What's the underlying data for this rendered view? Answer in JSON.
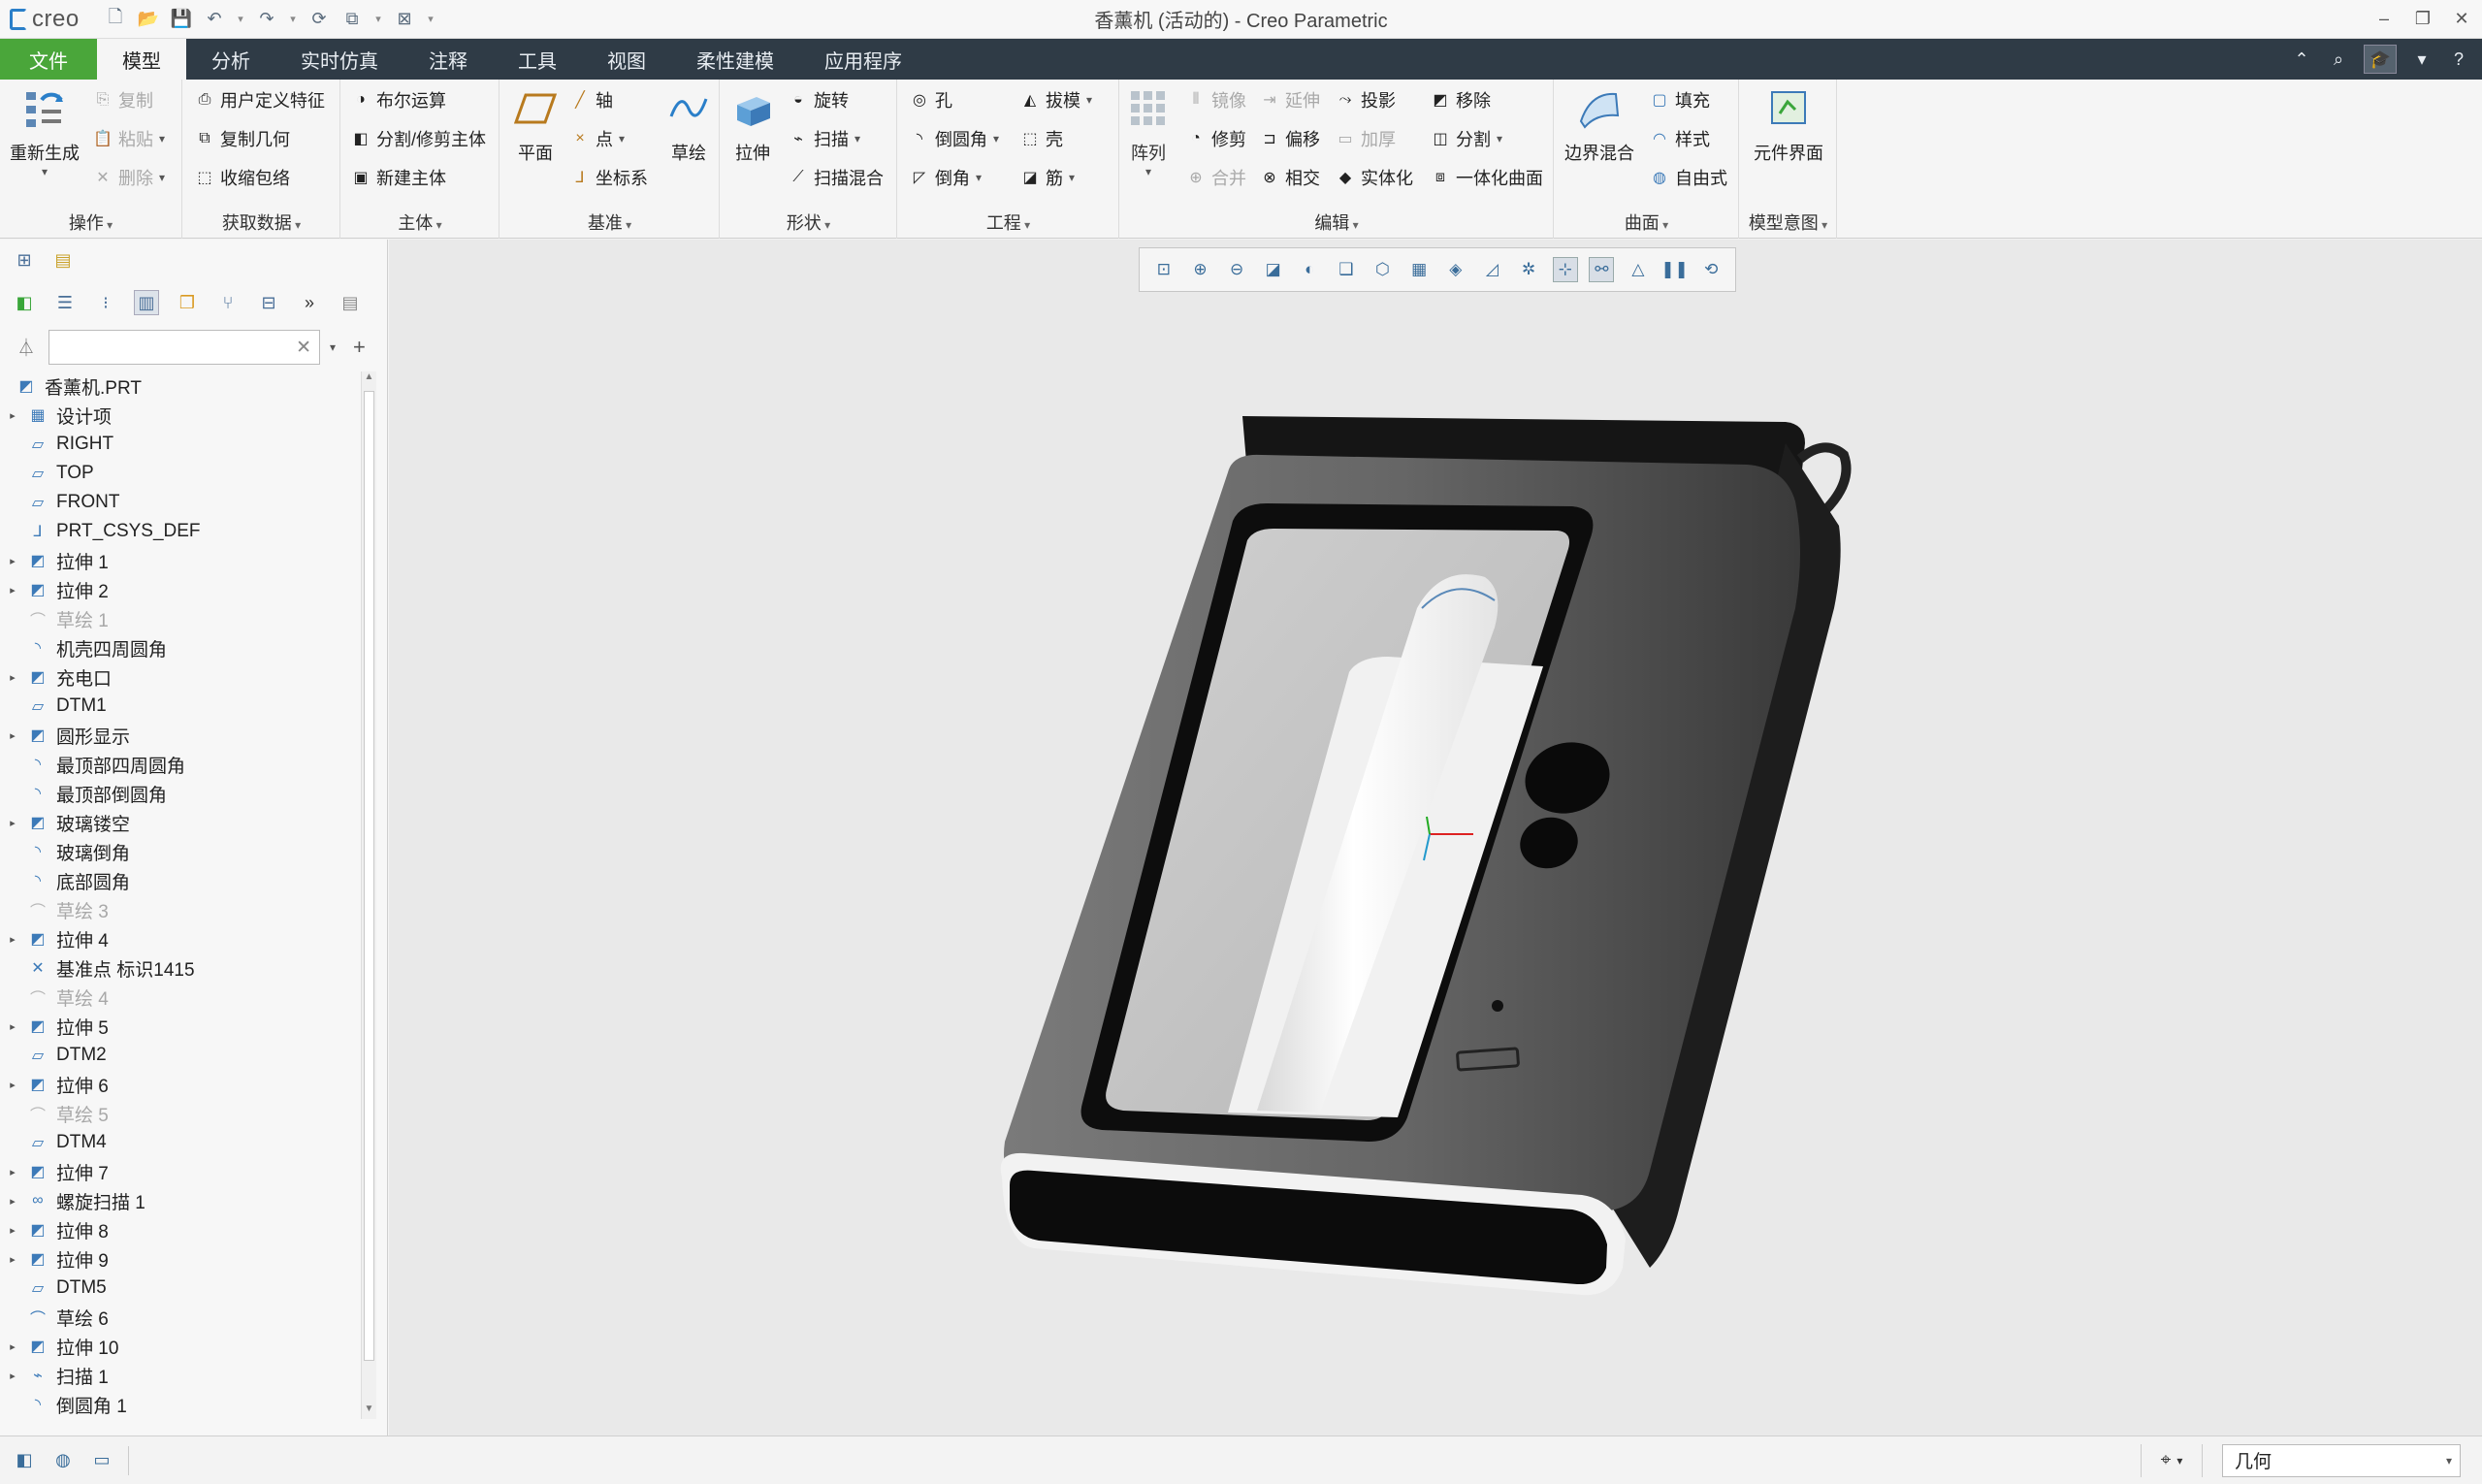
{
  "app": {
    "logo_text": "creo",
    "window_title": "香薰机 (活动的) - Creo Parametric"
  },
  "tabs": [
    "文件",
    "模型",
    "分析",
    "实时仿真",
    "注释",
    "工具",
    "视图",
    "柔性建模",
    "应用程序"
  ],
  "active_tab": "模型",
  "ribbon": {
    "operations": {
      "title": "操作",
      "regenerate": "重新生成",
      "copy": "复制",
      "paste": "粘贴",
      "delete": "删除"
    },
    "get_data": {
      "title": "获取数据",
      "udf": "用户定义特征",
      "copy_geom": "复制几何",
      "shrinkwrap": "收缩包络"
    },
    "body": {
      "title": "主体",
      "boolean": "布尔运算",
      "split_trim": "分割/修剪主体",
      "new_body": "新建主体"
    },
    "datum": {
      "title": "基准",
      "plane": "平面",
      "axis": "轴",
      "point": "点",
      "csys": "坐标系",
      "sketch": "草绘"
    },
    "shapes": {
      "title": "形状",
      "extrude": "拉伸",
      "revolve": "旋转",
      "sweep": "扫描",
      "swept_blend": "扫描混合"
    },
    "engineering": {
      "title": "工程",
      "hole": "孔",
      "round": "倒圆角",
      "chamfer": "倒角",
      "draft": "拔模",
      "shell": "壳",
      "rib": "筋"
    },
    "editing": {
      "title": "编辑",
      "pattern": "阵列",
      "mirror": "镜像",
      "trim": "修剪",
      "merge": "合并",
      "extend": "延伸",
      "offset": "偏移",
      "intersect": "相交",
      "project": "投影",
      "thicken": "加厚",
      "solidify": "实体化",
      "remove": "移除",
      "split": "分割",
      "unify_surface": "一体化曲面"
    },
    "surfaces": {
      "title": "曲面",
      "boundary_blend": "边界混合",
      "fill": "填充",
      "style": "样式",
      "freestyle": "自由式"
    },
    "model_intent": {
      "title": "模型意图",
      "component_interface": "元件界面"
    }
  },
  "model_tree": {
    "root": "香薰机.PRT",
    "items": [
      {
        "label": "设计项",
        "icon": "design-items-icon",
        "expandable": true,
        "dim": false
      },
      {
        "label": "RIGHT",
        "icon": "datum-plane-icon",
        "expandable": false,
        "dim": false
      },
      {
        "label": "TOP",
        "icon": "datum-plane-icon",
        "expandable": false,
        "dim": false
      },
      {
        "label": "FRONT",
        "icon": "datum-plane-icon",
        "expandable": false,
        "dim": false
      },
      {
        "label": "PRT_CSYS_DEF",
        "icon": "csys-icon",
        "expandable": false,
        "dim": false
      },
      {
        "label": "拉伸 1",
        "icon": "extrude-icon",
        "expandable": true,
        "dim": false
      },
      {
        "label": "拉伸 2",
        "icon": "extrude-icon",
        "expandable": true,
        "dim": false
      },
      {
        "label": "草绘 1",
        "icon": "sketch-icon",
        "expandable": false,
        "dim": true
      },
      {
        "label": "机壳四周圆角",
        "icon": "round-icon",
        "expandable": false,
        "dim": false
      },
      {
        "label": "充电口",
        "icon": "extrude-icon",
        "expandable": true,
        "dim": false
      },
      {
        "label": "DTM1",
        "icon": "datum-plane-icon",
        "expandable": false,
        "dim": false
      },
      {
        "label": "圆形显示",
        "icon": "extrude-icon",
        "expandable": true,
        "dim": false
      },
      {
        "label": "最顶部四周圆角",
        "icon": "round-icon",
        "expandable": false,
        "dim": false
      },
      {
        "label": "最顶部倒圆角",
        "icon": "round-icon",
        "expandable": false,
        "dim": false
      },
      {
        "label": "玻璃镂空",
        "icon": "extrude-icon",
        "expandable": true,
        "dim": false
      },
      {
        "label": "玻璃倒角",
        "icon": "round-icon",
        "expandable": false,
        "dim": false
      },
      {
        "label": "底部圆角",
        "icon": "round-icon",
        "expandable": false,
        "dim": false
      },
      {
        "label": "草绘 3",
        "icon": "sketch-icon",
        "expandable": false,
        "dim": true
      },
      {
        "label": "拉伸 4",
        "icon": "extrude-icon",
        "expandable": true,
        "dim": false
      },
      {
        "label": "基准点 标识1415",
        "icon": "datum-point-icon",
        "expandable": false,
        "dim": false
      },
      {
        "label": "草绘 4",
        "icon": "sketch-icon",
        "expandable": false,
        "dim": true
      },
      {
        "label": "拉伸 5",
        "icon": "extrude-icon",
        "expandable": true,
        "dim": false
      },
      {
        "label": "DTM2",
        "icon": "datum-plane-icon",
        "expandable": false,
        "dim": false
      },
      {
        "label": "拉伸 6",
        "icon": "extrude-icon",
        "expandable": true,
        "dim": false
      },
      {
        "label": "草绘 5",
        "icon": "sketch-icon",
        "expandable": false,
        "dim": true
      },
      {
        "label": "DTM4",
        "icon": "datum-plane-icon",
        "expandable": false,
        "dim": false
      },
      {
        "label": "拉伸 7",
        "icon": "extrude-icon",
        "expandable": true,
        "dim": false
      },
      {
        "label": "螺旋扫描 1",
        "icon": "helical-sweep-icon",
        "expandable": true,
        "dim": false
      },
      {
        "label": "拉伸 8",
        "icon": "extrude-icon",
        "expandable": true,
        "dim": false
      },
      {
        "label": "拉伸 9",
        "icon": "extrude-icon",
        "expandable": true,
        "dim": false
      },
      {
        "label": "DTM5",
        "icon": "datum-plane-icon",
        "expandable": false,
        "dim": false
      },
      {
        "label": "草绘 6",
        "icon": "sketch-icon",
        "expandable": false,
        "dim": false
      },
      {
        "label": "拉伸 10",
        "icon": "extrude-icon",
        "expandable": true,
        "dim": false
      },
      {
        "label": "扫描 1",
        "icon": "sweep-icon",
        "expandable": true,
        "dim": false
      },
      {
        "label": "倒圆角 1",
        "icon": "round-icon",
        "expandable": false,
        "dim": false
      }
    ]
  },
  "statusbar": {
    "selection_filter": "几何"
  },
  "colors": {
    "file_tab": "#4aa63a",
    "tab_bar": "#2f3b46",
    "accent": "#3c7ab8"
  }
}
